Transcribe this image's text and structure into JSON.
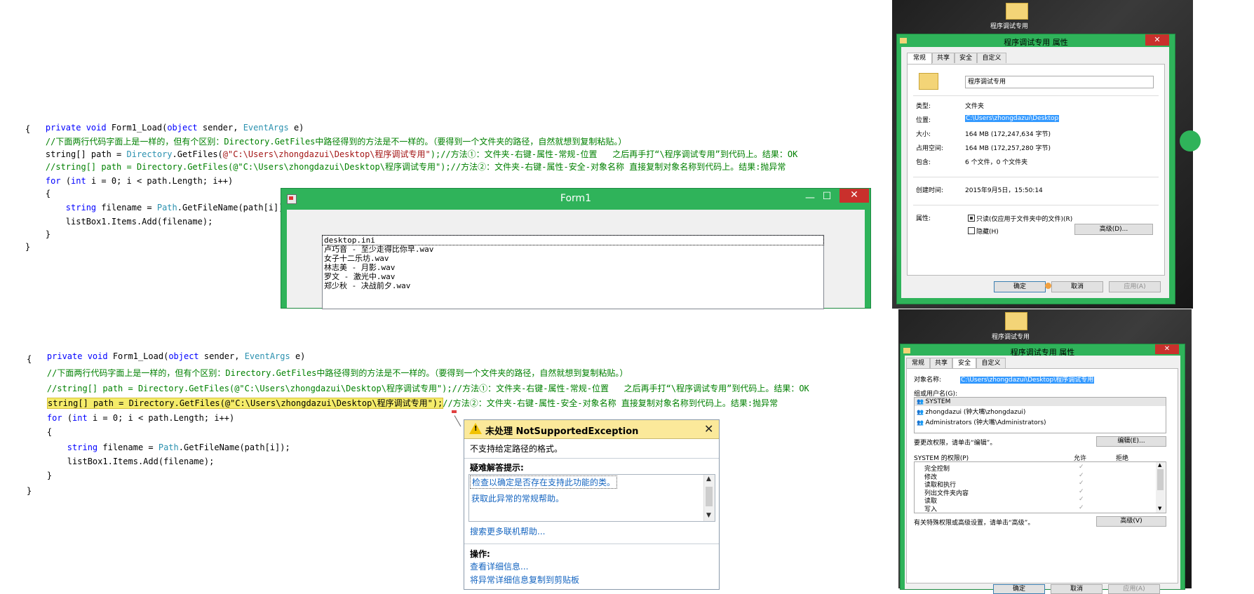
{
  "code_top": {
    "l1": "private void Form1_Load(object sender, EventArgs e)",
    "l2": "{",
    "l3": "    //下面两行代码字面上是一样的，但有个区别：Directory.GetFiles中路径得到的方法是不一样的。（要得到一个文件夹的路径，自然就想到复制粘贴。）",
    "l4a": "    string[] path = ",
    "l4b": "Directory",
    "l4c": ".GetFiles(",
    "l4d": "@\"C:\\Users\\zhongdazui\\Desktop\\程序调试专用\"",
    "l4e": ");//方法①：文件夹-右键-属性-常规-位置   之后再手打“\\程序调试专用”到代码上。结果：OK",
    "l5": "    //string[] path = Directory.GetFiles(@\"C:\\Users\\zhongdazui\\Desktop\\程序调试专用\");//方法②：文件夹-右键-属性-安全-对象名称 直接复制对象名称到代码上。结果:抛异常",
    "l6": "    for (int i = 0; i < path.Length; i++)",
    "l7": "    {",
    "l8": "        string filename = Path.GetFileName(path[i]);",
    "l9": "        listBox1.Items.Add(filename);",
    "l10": "    }",
    "l11": "}"
  },
  "code_bottom": {
    "l1": "private void Form1_Load(object sender, EventArgs e)",
    "l2": "{",
    "l3": "    //下面两行代码字面上是一样的，但有个区别：Directory.GetFiles中路径得到的方法是不一样的。（要得到一个文件夹的路径，自然就想到复制粘贴。）",
    "l4": "    //string[] path = Directory.GetFiles(@\"C:\\Users\\zhongdazui\\Desktop\\程序调试专用\");//方法①：文件夹-右键-属性-常规-位置   之后再手打“\\程序调试专用”到代码上。结果：OK",
    "l5a": "string[] path = Directory.GetFiles(@\"C:\\Users\\zhongdazui\\Desktop\\程序调试专用\");",
    "l5b": "//方法②：文件夹-右键-属性-安全-对象名称 直接复制对象名称到代码上。结果:抛异常",
    "l6": "    for (int i = 0; i < path.Length; i++)",
    "l7": "    {",
    "l8": "        string filename = Path.GetFileName(path[i]);",
    "l9": "        listBox1.Items.Add(filename);",
    "l10": "    }",
    "l11": "}"
  },
  "form1": {
    "title": "Form1",
    "listbox_items": [
      "desktop.ini",
      "卢巧音 - 至少走得比你早.wav",
      "女子十二乐坊.wav",
      "林志美 - 月影.wav",
      "罗文 - 激光中.wav",
      "郑少秋 - 决战前夕.wav"
    ]
  },
  "props_general": {
    "desktop_label": "程序调试专用",
    "title": "程序调试专用 属性",
    "tabs": [
      "常规",
      "共享",
      "安全",
      "自定义"
    ],
    "name_value": "程序调试专用",
    "rows": [
      {
        "k": "类型:",
        "v": "文件夹"
      },
      {
        "k": "位置:",
        "v": "C:\\Users\\zhongdazui\\Desktop"
      },
      {
        "k": "大小:",
        "v": "164 MB (172,247,634 字节)"
      },
      {
        "k": "占用空间:",
        "v": "164 MB (172,257,280 字节)"
      },
      {
        "k": "包含:",
        "v": "6 个文件，0 个文件夹"
      },
      {
        "k": "创建时间:",
        "v": "2015年9月5日，15:50:14"
      }
    ],
    "attr_label": "属性:",
    "readonly": "只读(仅应用于文件夹中的文件)(R)",
    "hidden": "隐藏(H)",
    "advanced": "高级(D)...",
    "ok": "确定",
    "cancel": "取消",
    "apply": "应用(A)"
  },
  "props_security": {
    "desktop_label": "程序调试专用",
    "title": "程序调试专用 属性",
    "tabs": [
      "常规",
      "共享",
      "安全",
      "自定义"
    ],
    "object_label": "对象名称:",
    "object_value": "C:\\Users\\zhongdazui\\Desktop\\程序调试专用",
    "group_label": "组或用户名(G):",
    "users": [
      "SYSTEM",
      "zhongdazui (钟大嘴\\zhongdazui)",
      "Administrators (钟大嘴\\Administrators)"
    ],
    "change_hint": "要更改权限，请单击“编辑”。",
    "edit": "编辑(E)...",
    "perm_label": "SYSTEM 的权限(P)",
    "allow": "允许",
    "deny": "拒绝",
    "perms": [
      "完全控制",
      "修改",
      "读取和执行",
      "列出文件夹内容",
      "读取",
      "写入"
    ],
    "special_hint": "有关特殊权限或高级设置，请单击“高级”。",
    "advanced": "高级(V)",
    "ok": "确定",
    "cancel": "取消",
    "apply": "应用(A)"
  },
  "exception": {
    "title": "未处理 NotSupportedException",
    "message": "不支持给定路径的格式。",
    "tips_header": "疑难解答提示:",
    "tip1": "检查以确定是否存在支持此功能的类。",
    "tip2": "获取此异常的常规帮助。",
    "more_help": "搜索更多联机帮助...",
    "actions_header": "操作:",
    "action1": "查看详细信息...",
    "action2": "将异常详细信息复制到剪贴板"
  }
}
